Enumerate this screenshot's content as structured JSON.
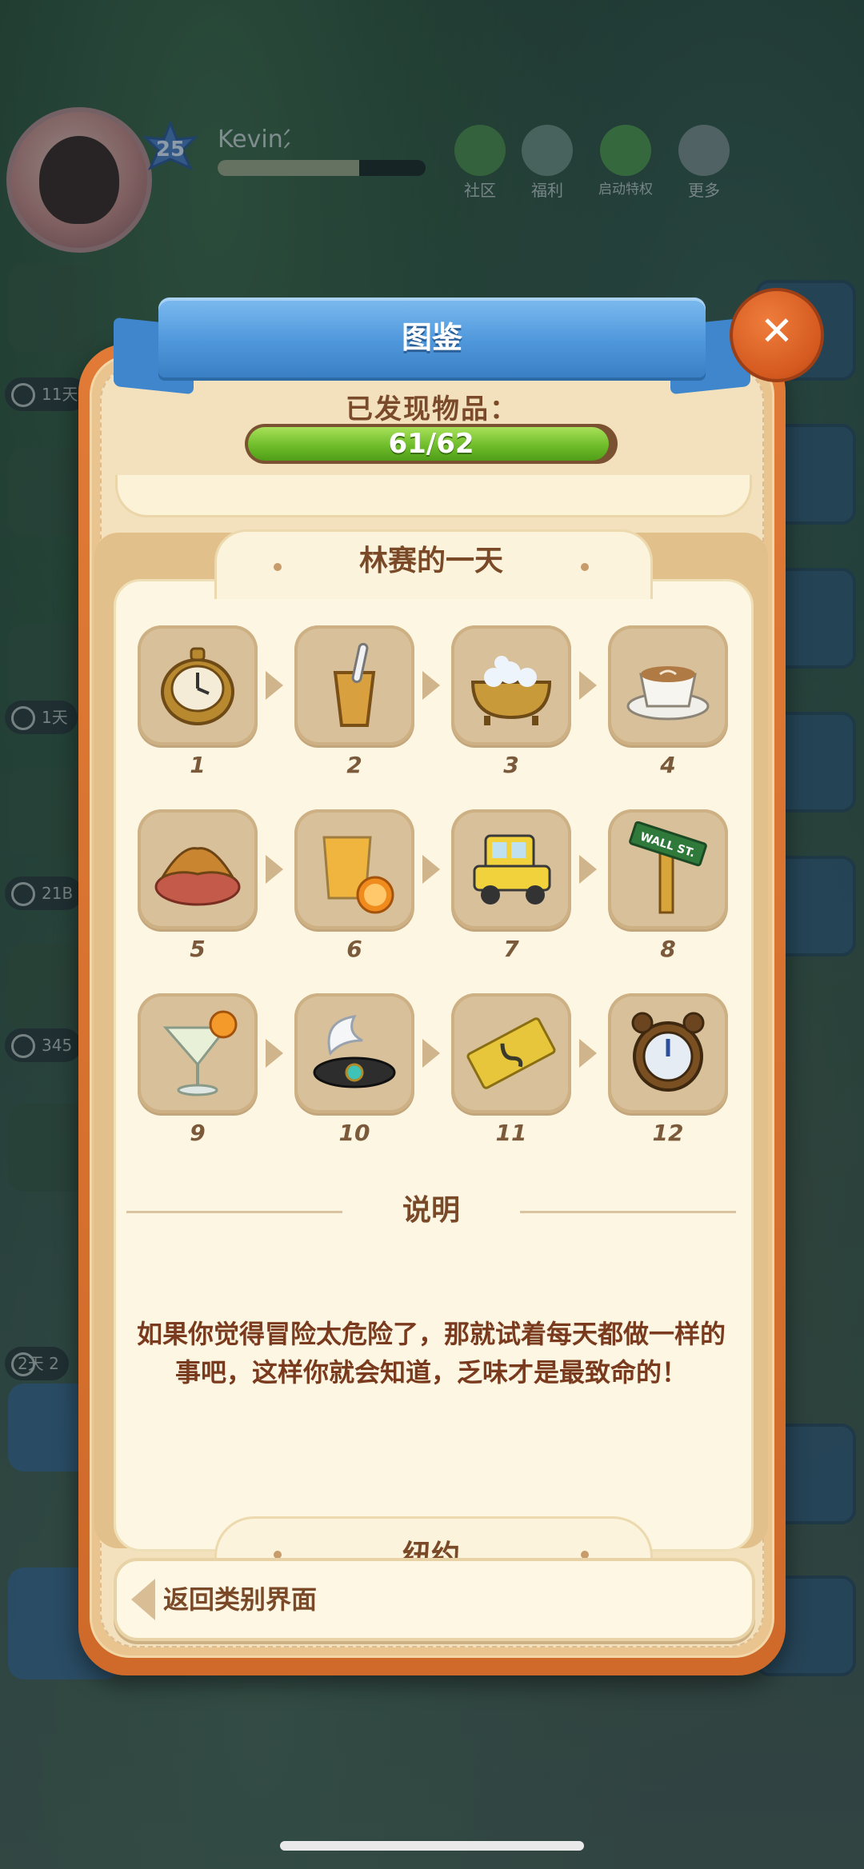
{
  "player": {
    "level": "25",
    "name": "Kevin⹄"
  },
  "top_menu": [
    {
      "id": "community",
      "label": "社区",
      "color": "#5fb06a"
    },
    {
      "id": "welfare",
      "label": "福利",
      "color": "#69a77b"
    },
    {
      "id": "launch-perks",
      "label": "启动特权",
      "color": "#59b865"
    },
    {
      "id": "more",
      "label": "更多",
      "color": "#8aa4a8"
    }
  ],
  "timers": [
    "11天",
    "1天",
    "21B",
    "345",
    "2天 2"
  ],
  "dialog": {
    "title": "图鉴",
    "close_icon": "close-icon",
    "found_label": "已发现物品：",
    "progress_text": "61/62",
    "progress_fraction": 0.984
  },
  "collection": {
    "set_title": "林赛的一天",
    "items": [
      {
        "num": "1",
        "icon": "pocket-watch-icon"
      },
      {
        "num": "2",
        "icon": "toothbrush-cup-icon"
      },
      {
        "num": "3",
        "icon": "bathtub-icon"
      },
      {
        "num": "4",
        "icon": "latte-cup-icon"
      },
      {
        "num": "5",
        "icon": "croissant-icon"
      },
      {
        "num": "6",
        "icon": "orange-juice-icon"
      },
      {
        "num": "7",
        "icon": "taxi-icon"
      },
      {
        "num": "8",
        "icon": "street-sign-icon"
      },
      {
        "num": "9",
        "icon": "cocktail-icon"
      },
      {
        "num": "10",
        "icon": "feather-headband-icon"
      },
      {
        "num": "11",
        "icon": "ticket-icon"
      },
      {
        "num": "12",
        "icon": "alarm-clock-icon"
      }
    ],
    "street_sign_text": "WALL ST.",
    "description_title": "说明",
    "description": "如果你觉得冒险太危险了，那就试着每天都做一样的事吧，这样你就会知道，乏味才是最致命的！",
    "next_set_title": "纽约"
  },
  "back_button": {
    "label": "返回类别界面"
  },
  "colors": {
    "ribbon_blue": "#4f97db",
    "frame_orange": "#e07a36",
    "progress_green": "#6fbd2a",
    "text_brown": "#7a4a28"
  }
}
